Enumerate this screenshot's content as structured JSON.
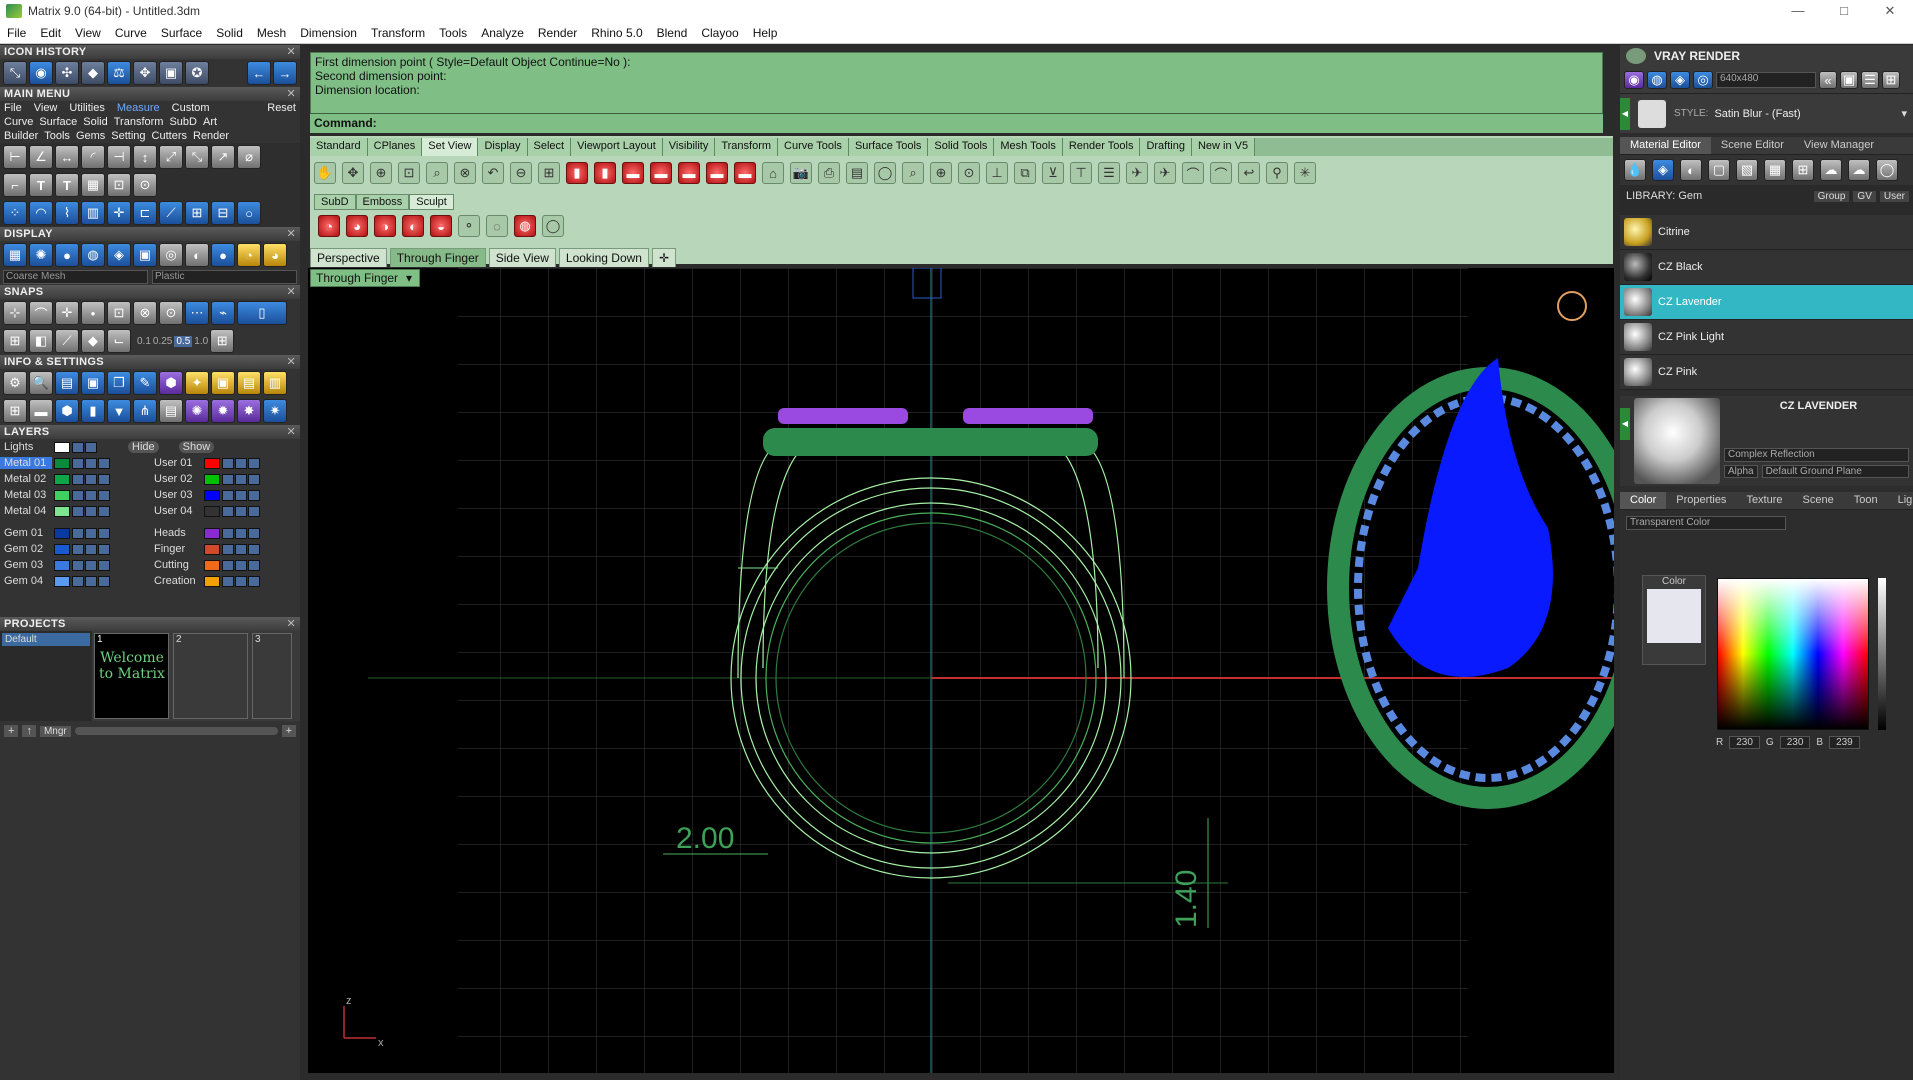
{
  "window": {
    "title": "Matrix 9.0 (64-bit) - Untitled.3dm",
    "controls": [
      "—",
      "□",
      "✕"
    ]
  },
  "menu": [
    "File",
    "Edit",
    "View",
    "Curve",
    "Surface",
    "Solid",
    "Mesh",
    "Dimension",
    "Transform",
    "Tools",
    "Analyze",
    "Render",
    "Rhino 5.0",
    "Blend",
    "Clayoo",
    "Help"
  ],
  "left": {
    "icon_history": "ICON HISTORY",
    "main_menu": "MAIN MENU",
    "main_menu_row1": [
      "File",
      "View",
      "Utilities",
      "Measure",
      "Custom",
      "Reset"
    ],
    "main_menu_row2": [
      "Curve",
      "Surface",
      "Solid",
      "Transform",
      "SubD",
      "Art"
    ],
    "main_menu_row3": [
      "Builder",
      "Tools",
      "Gems",
      "Setting",
      "Cutters",
      "Render"
    ],
    "display": "DISPLAY",
    "display_mesh": "Coarse Mesh",
    "display_material": "Plastic",
    "snaps": "SNAPS",
    "snap_values": [
      "0.1",
      "0.25",
      "0.5",
      "1.0"
    ],
    "info_settings": "INFO & SETTINGS",
    "layers": "LAYERS",
    "lights": "Lights",
    "hide": "Hide",
    "show": "Show",
    "layers_left": [
      {
        "name": "Metal 01",
        "color": "#0a8a3a"
      },
      {
        "name": "Metal 02",
        "color": "#0fa64a"
      },
      {
        "name": "Metal 03",
        "color": "#40d060"
      },
      {
        "name": "Metal 04",
        "color": "#7fe48f"
      },
      {
        "name": "Gem 01",
        "color": "#0a3aa0"
      },
      {
        "name": "Gem 02",
        "color": "#1a5ad0"
      },
      {
        "name": "Gem 03",
        "color": "#3a7ae0"
      },
      {
        "name": "Gem 04",
        "color": "#5a9af0"
      }
    ],
    "layers_right": [
      {
        "name": "User 01",
        "color": "#ff0000"
      },
      {
        "name": "User 02",
        "color": "#00c000"
      },
      {
        "name": "User 03",
        "color": "#0000ff"
      },
      {
        "name": "User 04",
        "color": "#333333"
      },
      {
        "name": "Heads",
        "color": "#8a2ad0"
      },
      {
        "name": "Finger",
        "color": "#d04a2a"
      },
      {
        "name": "Cutting",
        "color": "#f06a1a"
      },
      {
        "name": "Creation",
        "color": "#f0a000"
      }
    ],
    "projects": "PROJECTS",
    "project_default": "Default",
    "proj_thumb_nums": [
      "1",
      "2",
      "3"
    ],
    "welcome": "Welcome to Matrix",
    "mngr": "Mngr"
  },
  "command": {
    "lines": [
      "First dimension point ( Style=Default  Object  Continue=No ):",
      "Second dimension point:",
      "Dimension location:"
    ],
    "prompt": "Command:"
  },
  "tabs": [
    "Standard",
    "CPlanes",
    "Set View",
    "Display",
    "Select",
    "Viewport Layout",
    "Visibility",
    "Transform",
    "Curve Tools",
    "Surface Tools",
    "Solid Tools",
    "Mesh Tools",
    "Render Tools",
    "Drafting",
    "New in V5"
  ],
  "subtabs": [
    "SubD",
    "Emboss",
    "Sculpt"
  ],
  "viewport_tabs": [
    "Perspective",
    "Through Finger",
    "Side View",
    "Looking Down"
  ],
  "viewport_label": "Through Finger",
  "dims": {
    "d1": "2.00",
    "d2": "1.40"
  },
  "axes": {
    "z": "z",
    "x": "x"
  },
  "right": {
    "title": "VRAY RENDER",
    "resolution": "640x480",
    "style_label": "STYLE:",
    "style": "Satin Blur - (Fast)",
    "tabs": [
      "Material Editor",
      "Scene Editor",
      "View Manager"
    ],
    "library": "LIBRARY: Gem",
    "lib_btns": [
      "Group",
      "GV",
      "User"
    ],
    "materials": [
      "Citrine",
      "CZ Black",
      "CZ Lavender",
      "CZ Pink Light",
      "CZ Pink"
    ],
    "selected_material": "CZ LAVENDER",
    "reflection": "Complex Reflection",
    "alpha": "Alpha",
    "ground": "Default Ground Plane",
    "prop_tabs": [
      "Color",
      "Properties",
      "Texture",
      "Scene",
      "Toon",
      "Lights"
    ],
    "color_mode": "Transparent Color",
    "color_label": "Color",
    "rgb": {
      "r_label": "R",
      "r": "230",
      "g_label": "G",
      "g": "230",
      "b_label": "B",
      "b": "239"
    }
  }
}
